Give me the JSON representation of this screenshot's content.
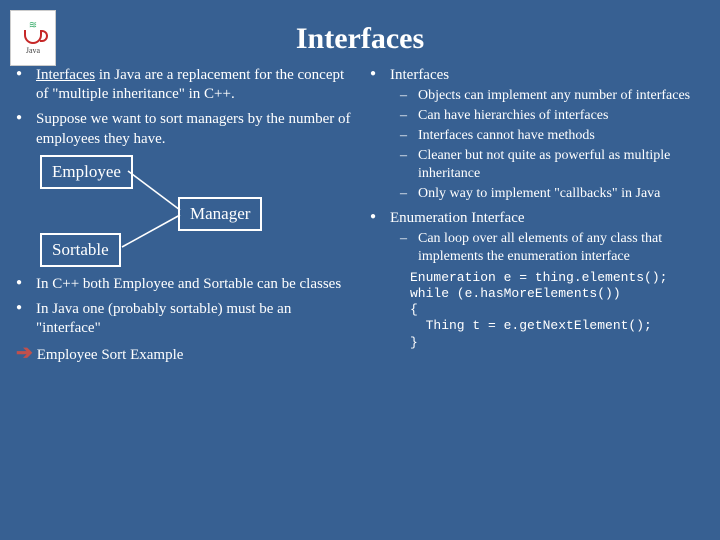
{
  "logo": {
    "label": "Java"
  },
  "title": "Interfaces",
  "left": {
    "b1a": "Interfaces",
    "b1b": " in Java are a replacement for the concept of \"multiple inheritance\" in C++.",
    "b2": "Suppose we want to sort managers by the number of employees they have.",
    "diagram": {
      "employee": "Employee",
      "manager": "Manager",
      "sortable": "Sortable"
    },
    "b3": "In C++ both Employee and Sortable can be classes",
    "b4": "In Java one (probably sortable) must be an \"interface\"",
    "arrow_label": "Employee Sort Example"
  },
  "right": {
    "h1": "Interfaces",
    "h1_items": [
      "Objects can implement any number of interfaces",
      "Can have hierarchies of interfaces",
      "Interfaces cannot have methods",
      "Cleaner but not quite as powerful as multiple inheritance",
      "Only way to implement \"callbacks\" in Java"
    ],
    "h2": "Enumeration Interface",
    "h2_item": "Can loop over all elements of any class that implements the enumeration interface",
    "code": "Enumeration e = thing.elements();\nwhile (e.hasMoreElements())\n{\n  Thing t = e.getNextElement();\n}"
  }
}
